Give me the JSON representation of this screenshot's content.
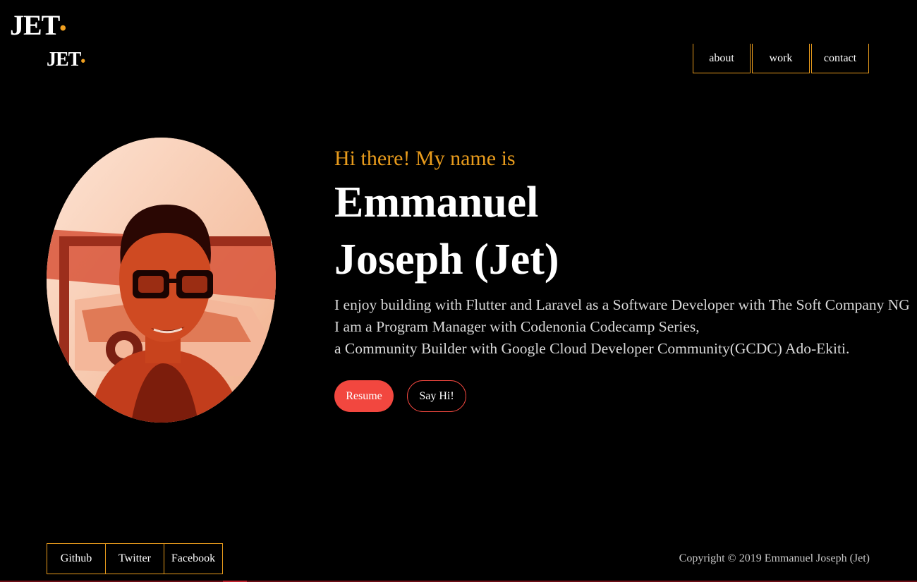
{
  "brand": {
    "logo_text": "JET",
    "logo_dot": "•",
    "accent_color": "#e89b1c"
  },
  "nav": {
    "items": [
      {
        "label": "about"
      },
      {
        "label": "work"
      },
      {
        "label": "contact"
      }
    ]
  },
  "hero": {
    "greeting": "Hi there! My name is",
    "name_line1": "Emmanuel",
    "name_line2": "Joseph (Jet)",
    "bio": [
      "I enjoy building with Flutter and Laravel as a Software Developer with The Soft Company NG",
      "I am a Program Manager with Codenonia Codecamp Series,",
      "a Community Builder with Google Cloud Developer Community(GCDC) Ado-Ekiti."
    ],
    "buttons": {
      "resume": "Resume",
      "say_hi": "Say Hi!"
    },
    "button_color": "#f2473f"
  },
  "social": {
    "items": [
      {
        "label": "Github"
      },
      {
        "label": "Twitter"
      },
      {
        "label": "Facebook"
      }
    ]
  },
  "footer": {
    "copyright": "Copyright © 2019 Emmanuel Joseph (Jet)"
  }
}
